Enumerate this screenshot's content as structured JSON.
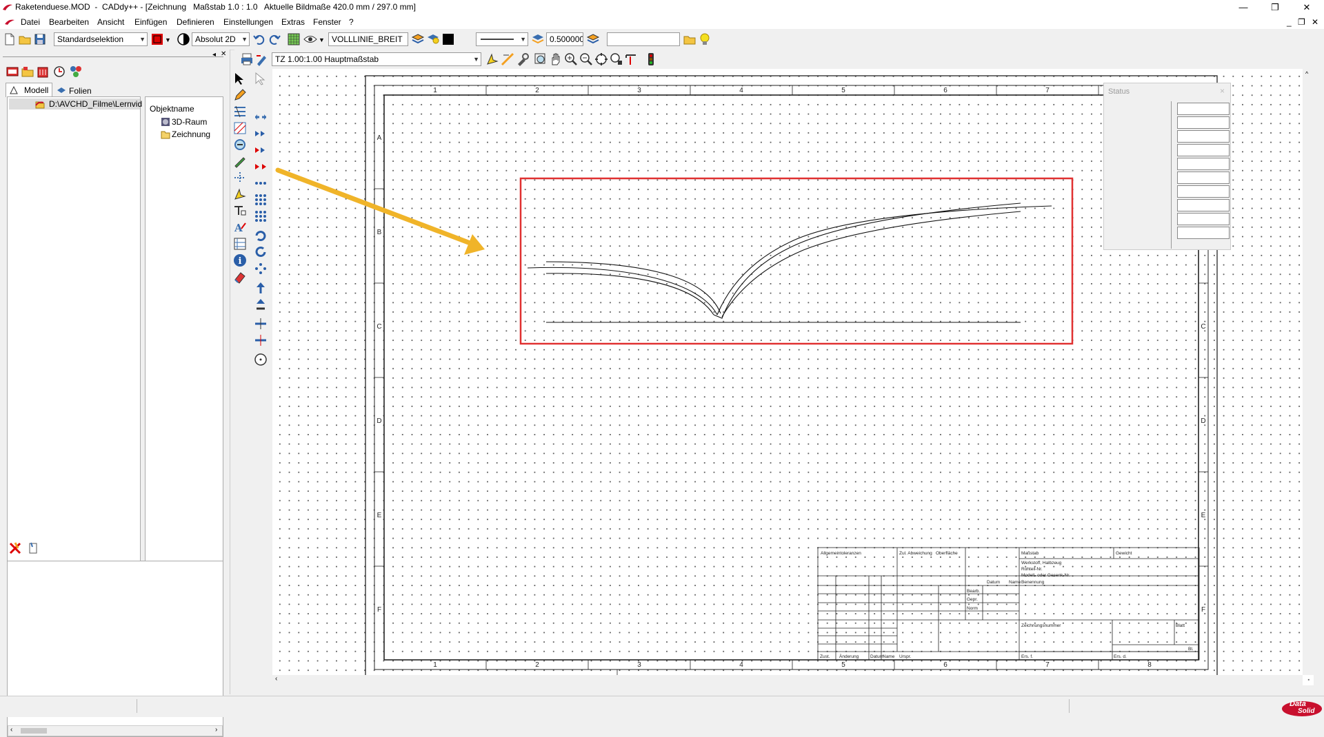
{
  "window": {
    "title": "Raketenduese.MOD  -  CADdy++ - [Zeichnung   Maßstab 1.0 : 1.0   Aktuelle Bildmaße 420.0 mm / 297.0 mm]",
    "minimize": "—",
    "maximize": "❐",
    "close": "✕"
  },
  "menu": {
    "items": [
      "Datei",
      "Bearbeiten",
      "Ansicht",
      "Einfügen",
      "Definieren",
      "Einstellungen",
      "Extras",
      "Fenster",
      "?"
    ],
    "child_minimize": "_",
    "child_restore": "❐",
    "child_close": "✕"
  },
  "toolbar": {
    "selection_mode": "Standardselektion",
    "coordinate_mode": "Absolut 2D",
    "line_type": "VOLLLINIE_BREIT",
    "line_width": "0.500000",
    "search_value": ""
  },
  "toolbar2": {
    "scale_combo": "TZ 1.00:1.00 Hauptmaßstab"
  },
  "left_panel": {
    "tabs": [
      "Modell",
      "Folien"
    ],
    "tree_path": "D:\\AVCHD_Filme\\Lernvid",
    "object_header": "Objektname",
    "objects": [
      "3D-Raum",
      "Zeichnung"
    ]
  },
  "status_panel": {
    "title": "Status",
    "close": "×"
  },
  "frame": {
    "columns": [
      "1",
      "2",
      "3",
      "4",
      "5",
      "6",
      "7",
      "8"
    ],
    "rows": [
      "A",
      "B",
      "C",
      "D",
      "E",
      "F"
    ]
  },
  "title_block": {
    "allgemein": "Allgemeintoleranzen",
    "abweichung": "Zul. Abweichung",
    "oberflaeche": "Oberfläche",
    "massstab": "Maßstab",
    "gewicht": "Gewicht",
    "werkstoff": "Werkstoff, Halbzeug",
    "rohteil": "Rohteil-Nr.",
    "modell": "Modell- oder Gesenk-Nr.",
    "datum": "Datum",
    "name": "Name",
    "benennung": "Benennung",
    "bearb": "Bearb.",
    "gepr": "Gepr.",
    "norm": "Norm",
    "zeichnungsnummer": "Zeichnungsnummer",
    "blatt": "Blatt",
    "bl": "Bl.",
    "zust": "Zust.",
    "aenderung": "Änderung",
    "datum2": "Datum",
    "name2": "Name",
    "urspr": "Urspr.",
    "ers_f": "Ers. f.",
    "ers_d": "Ers. d."
  },
  "colors": {
    "highlight_rect": "#e03030",
    "arrow": "#f0b429",
    "brand_red": "#c8102e"
  },
  "logo": {
    "line1": "Data",
    "line2": "Solid"
  }
}
